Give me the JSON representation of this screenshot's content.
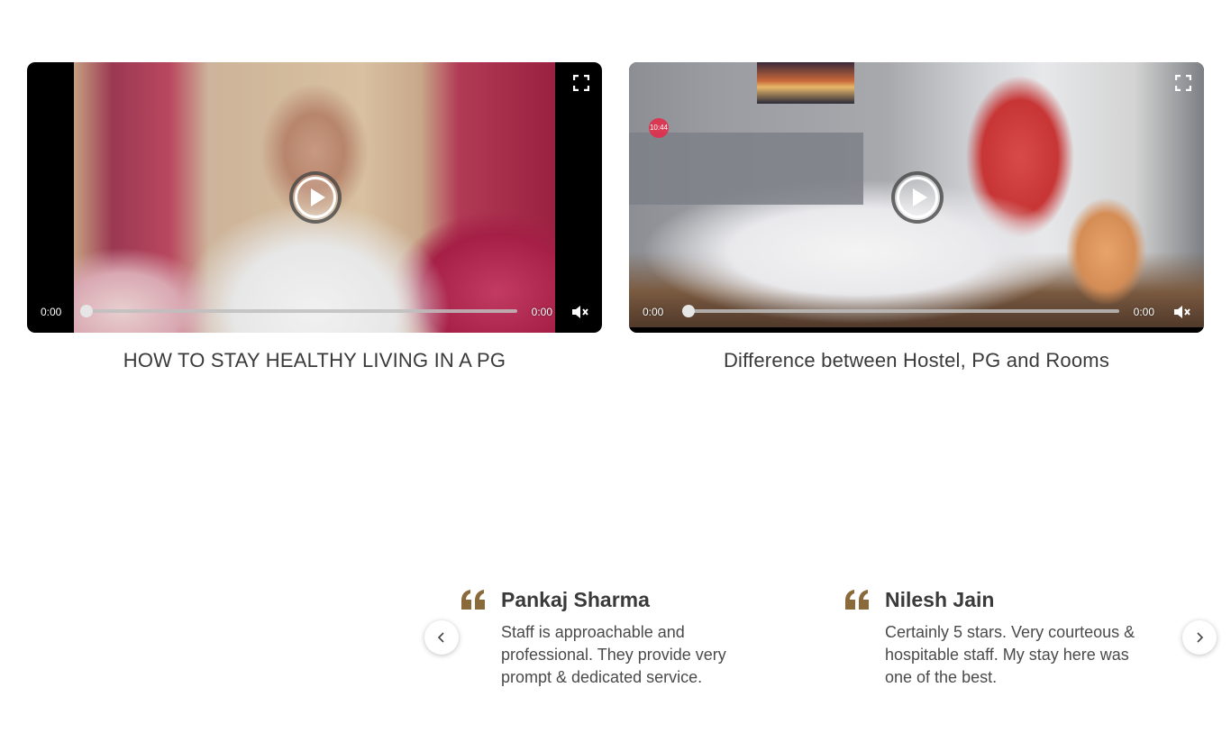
{
  "videos": [
    {
      "title": "HOW TO STAY HEALTHY LIVING IN A PG",
      "current_time": "0:00",
      "duration": "0:00",
      "progress": 0,
      "muted": true
    },
    {
      "title": "Difference between Hostel, PG and Rooms",
      "current_time": "0:00",
      "duration": "0:00",
      "progress": 0,
      "muted": true,
      "overlay_badge": "10:44"
    }
  ],
  "testimonials": [
    {
      "name": "Pankaj Sharma",
      "text": "Staff is approachable and professional. They provide very prompt & dedicated service."
    },
    {
      "name": "Nilesh Jain",
      "text": "Certainly 5 stars. Very courteous & hospitable staff. My stay here was one of the best."
    }
  ],
  "icons": {
    "play": "play-icon",
    "fullscreen": "fullscreen-icon",
    "mute": "volume-muted-icon",
    "quote": "quote-icon",
    "prev": "chevron-left-icon",
    "next": "chevron-right-icon"
  },
  "colors": {
    "quote_accent": "#8a6a3a",
    "title_text": "#3a3a3a"
  }
}
